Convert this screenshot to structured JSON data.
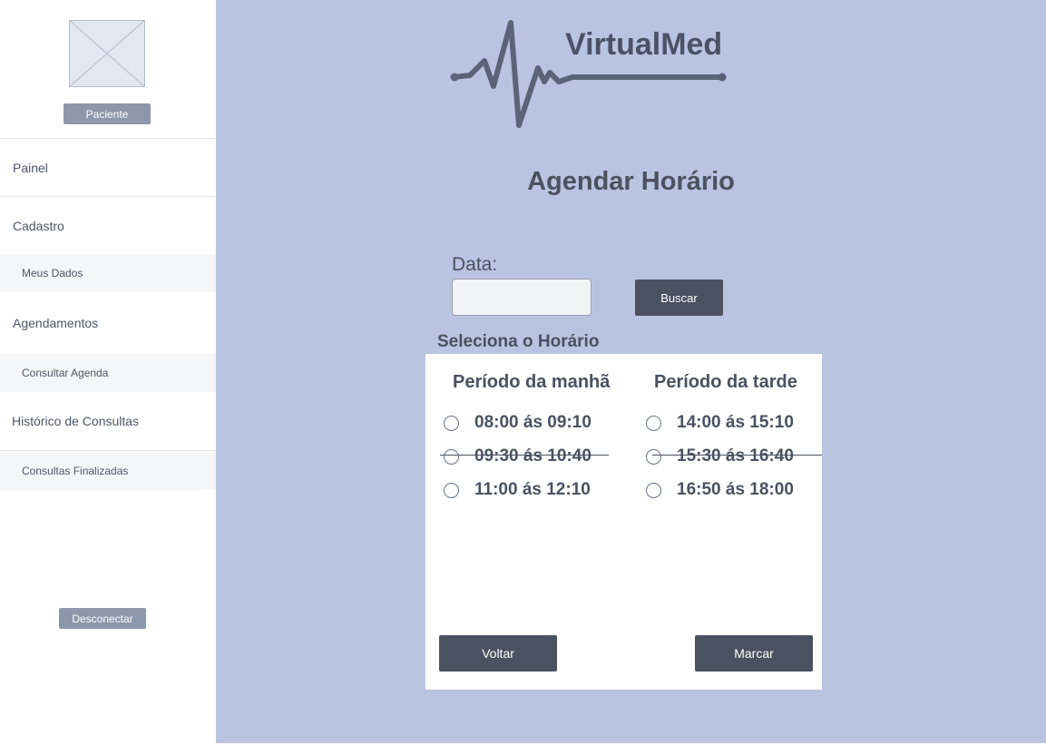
{
  "sidebar": {
    "role_label": "Paciente",
    "logout_label": "Desconectar",
    "items": [
      {
        "label": "Painel"
      },
      {
        "label": "Cadastro"
      },
      {
        "label": "Meus Dados"
      },
      {
        "label": "Agendamentos"
      },
      {
        "label": "Consultar Agenda"
      },
      {
        "label": "Histórico de Consultas"
      },
      {
        "label": "Consultas Finalizadas"
      }
    ]
  },
  "brand": {
    "name": "VirtualMed"
  },
  "page": {
    "title": "Agendar Horário"
  },
  "search": {
    "date_label": "Data:",
    "date_value": "",
    "button_label": "Buscar"
  },
  "schedule": {
    "select_label": "Seleciona  o Horário",
    "morning": {
      "title": "Período da manhã",
      "slots": [
        {
          "label": "08:00 ás 09:10",
          "unavailable": false
        },
        {
          "label": "09:30 ás 10:40",
          "unavailable": true
        },
        {
          "label": "11:00 ás 12:10",
          "unavailable": false
        }
      ]
    },
    "afternoon": {
      "title": "Período da tarde",
      "slots": [
        {
          "label": "14:00 ás 15:10",
          "unavailable": false
        },
        {
          "label": "15:30 ás 16:40",
          "unavailable": true
        },
        {
          "label": "16:50 ás 18:00",
          "unavailable": false
        }
      ]
    },
    "back_label": "Voltar",
    "confirm_label": "Marcar"
  },
  "colors": {
    "main_bg": "#b9c5e0",
    "button_dark": "#4a5160",
    "button_muted": "#8d97ab"
  }
}
